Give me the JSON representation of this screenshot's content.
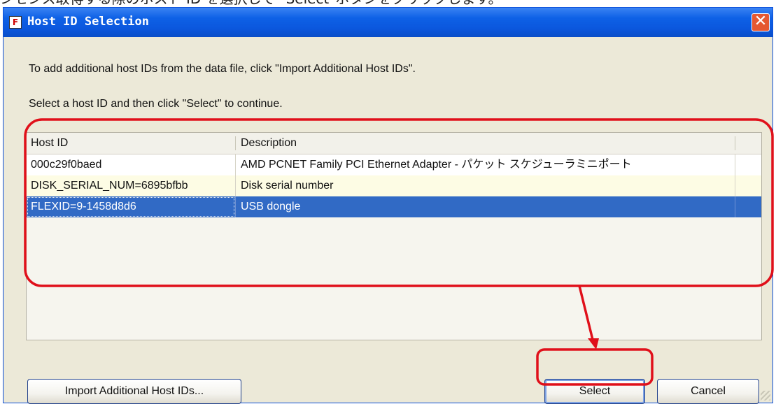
{
  "caption": "ンセンス取得する際のホスト ID を選択して \"Select\"ボタンをクリックします。",
  "dialog": {
    "title": "Host ID Selection",
    "close_glyph": "✕",
    "app_icon": "flexnet-app-icon"
  },
  "instructions": [
    "To add additional host IDs from the data file, click \"Import Additional Host IDs\".",
    "Select a host ID and then click \"Select\" to continue."
  ],
  "table": {
    "columns": [
      "Host ID",
      "Description"
    ],
    "rows": [
      {
        "host_id": "000c29f0baed",
        "description": "AMD PCNET Family PCI Ethernet Adapter - パケット スケジューラミニポート"
      },
      {
        "host_id": "DISK_SERIAL_NUM=6895bfbb",
        "description": "Disk serial number"
      },
      {
        "host_id": "FLEXID=9-1458d8d6",
        "description": "USB dongle"
      }
    ],
    "selected_row": "FLEXID=9-1458d8d6",
    "row_colors": [
      "#ffffff",
      "#fdfce4",
      "#316ac5"
    ]
  },
  "buttons": {
    "import": "Import Additional Host IDs...",
    "select": "Select",
    "cancel": "Cancel"
  },
  "annotation_color": "#e0101a"
}
